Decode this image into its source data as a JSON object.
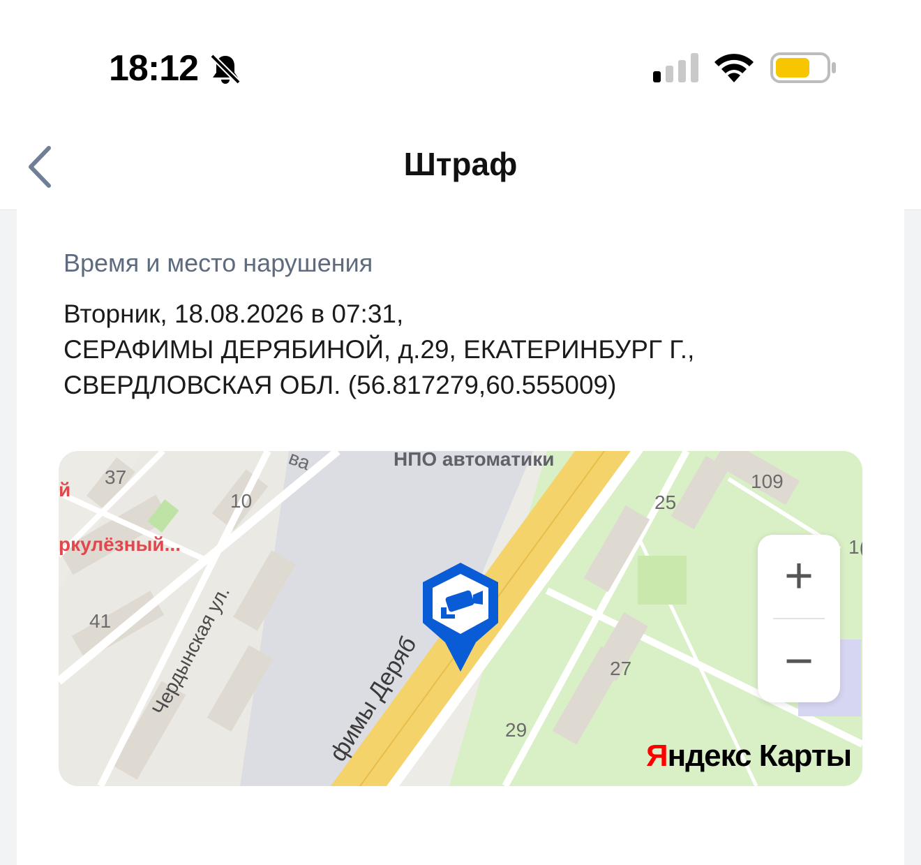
{
  "status_bar": {
    "time": "18:12",
    "icons": [
      "bell-slash-icon",
      "cellular-signal-icon",
      "wifi-icon",
      "battery-icon"
    ],
    "battery_color": "#f7c600"
  },
  "header": {
    "title": "Штраф",
    "back_icon": "chevron-left-icon"
  },
  "violation": {
    "section_label": "Время и место нарушения",
    "lines": [
      "Вторник, 18.08.2026 в 07:31,",
      "СЕРАФИМЫ ДЕРЯБИНОЙ, д.29, ЕКАТЕРИНБУРГ Г.,",
      "СВЕРДЛОВСКАЯ ОБЛ. (56.817279,60.555009)"
    ]
  },
  "map": {
    "labels": {
      "npo": "НПО автоматики",
      "n37": "37",
      "n10": "10",
      "n41": "41",
      "n25": "25",
      "n109": "109",
      "n27": "27",
      "n29": "29",
      "n10_partial": "1(",
      "street_cherdyn": "Чердынская ул.",
      "street_serafimy": "фимы Деряб",
      "poi": "ркулёзный...",
      "poi_letter": "й",
      "partial_va": "ва"
    },
    "zoom_in": "+",
    "zoom_out": "−",
    "brand_y": "Я",
    "brand_rest": "ндекс Карты",
    "marker_icon": "camera-icon",
    "colors": {
      "road": "#f5d36b",
      "park": "#d6efc0",
      "marker": "#0a5bd6"
    }
  }
}
